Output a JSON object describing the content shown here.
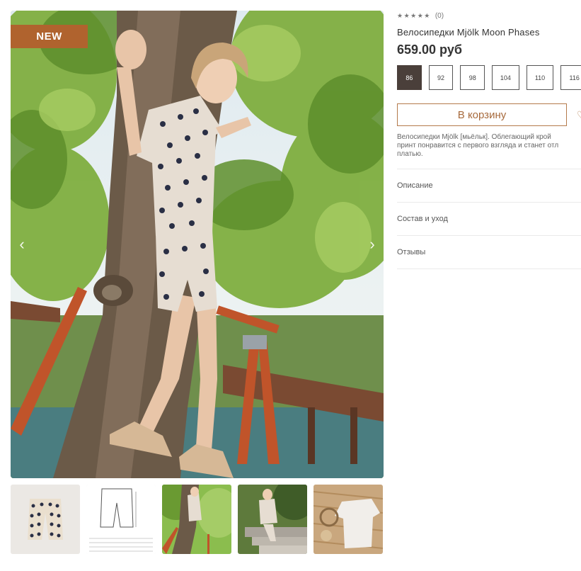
{
  "gallery": {
    "badge": "NEW",
    "prev_icon": "chevron-left-icon",
    "next_icon": "chevron-right-icon",
    "thumbnails": [
      {
        "name": "thumb-shorts-flat"
      },
      {
        "name": "thumb-size-chart"
      },
      {
        "name": "thumb-tree-photo"
      },
      {
        "name": "thumb-stairs-photo"
      },
      {
        "name": "thumb-set-flatlay"
      }
    ]
  },
  "product": {
    "stars": "★★★★★",
    "reviews_count": "(0)",
    "title": "Велосипедки Mjölk Moon Phases",
    "price": "659.00 руб",
    "sizes": [
      "86",
      "92",
      "98",
      "104",
      "110",
      "116"
    ],
    "selected_size": "86",
    "cart_button": "В корзину",
    "wishlist_icon": "heart-icon",
    "description_lines": [
      "Велосипедки Mjölk [мьёльк]. Облегающий крой",
      "принт понравится с первого взгляда и станет отл",
      "платью."
    ]
  },
  "accordion": [
    "Описание",
    "Состав и уход",
    "Отзывы"
  ],
  "colors": {
    "accent": "#b0632e",
    "selected_size": "#4a3f3a"
  }
}
